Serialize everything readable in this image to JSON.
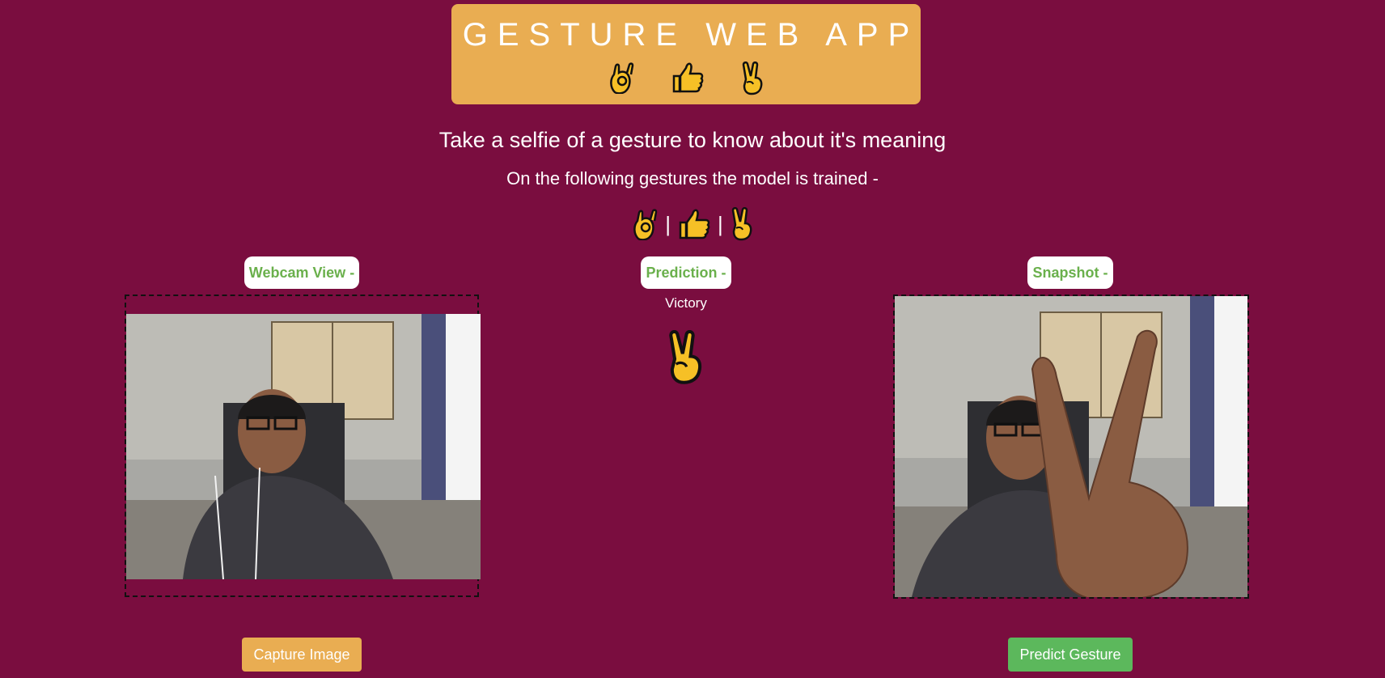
{
  "header": {
    "title": "GESTURE WEB APP",
    "emojis": [
      "ok-hand-icon",
      "thumbs-up-icon",
      "victory-hand-icon"
    ]
  },
  "intro": {
    "heading": "Take a selfie of a gesture to know about it's meaning",
    "subheading": "On the following gestures the model is trained -",
    "gestures": [
      "ok-hand-icon",
      "thumbs-up-icon",
      "victory-hand-icon"
    ],
    "separator": "|"
  },
  "webcam": {
    "label": "Webcam View -"
  },
  "prediction": {
    "label": "Prediction -",
    "result": "Victory",
    "result_icon": "victory-hand-icon"
  },
  "snapshot": {
    "label": "Snapshot -"
  },
  "buttons": {
    "capture": "Capture Image",
    "predict": "Predict Gesture"
  },
  "colors": {
    "background": "#7a0d3f",
    "header_bg": "#e9ad52",
    "label_text": "#6ab04c",
    "capture_button": "#e9ad52",
    "predict_button": "#5cb85c",
    "emoji_fill": "#f6c026"
  }
}
